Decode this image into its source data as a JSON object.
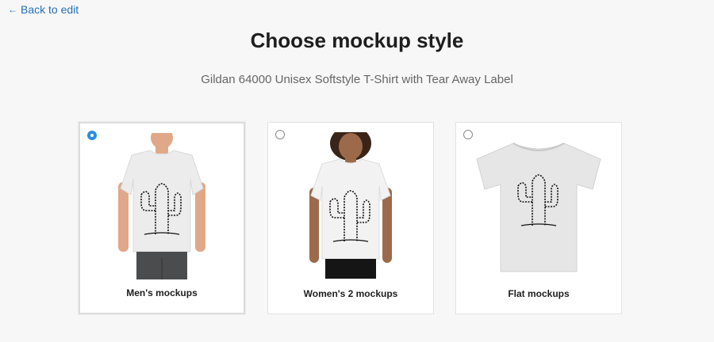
{
  "nav": {
    "back_label": "Back to edit"
  },
  "header": {
    "title": "Choose mockup style",
    "subtitle": "Gildan 64000 Unisex Softstyle T-Shirt with Tear Away Label"
  },
  "options": [
    {
      "label": "Men's mockups",
      "selected": true
    },
    {
      "label": "Women's 2 mockups",
      "selected": false
    },
    {
      "label": "Flat mockups",
      "selected": false
    }
  ],
  "colors": {
    "accent": "#2d8ce3",
    "link": "#2470b8"
  }
}
